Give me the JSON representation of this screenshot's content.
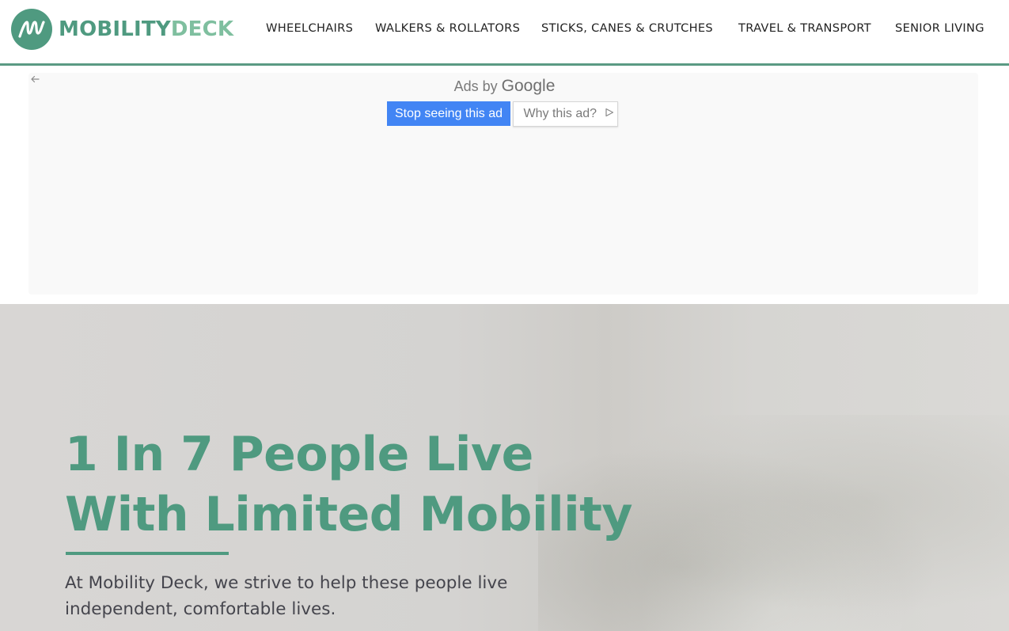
{
  "brand": {
    "name_part1": "MOBILITY",
    "name_part2": "DECK",
    "logo_icon": "mobility-deck-logo-icon",
    "colors": {
      "primary": "#4f9a80",
      "secondary": "#7fbf9f"
    }
  },
  "nav": {
    "items": [
      {
        "label": "WHEELCHAIRS"
      },
      {
        "label": "WALKERS & ROLLATORS"
      },
      {
        "label": "STICKS, CANES & CRUTCHES"
      },
      {
        "label": "TRAVEL & TRANSPORT"
      },
      {
        "label": "SENIOR LIVING"
      }
    ]
  },
  "ad": {
    "ads_by": "Ads by",
    "google": "Google",
    "stop_label": "Stop seeing this ad",
    "why_label": "Why this ad?",
    "back_icon": "back-arrow-icon",
    "why_icon": "play-triangle-icon",
    "colors": {
      "stop_button": "#4285f4"
    }
  },
  "hero": {
    "title_line1": "1 In 7 People Live",
    "title_line2": "With Limited Mobility",
    "subtitle_line1": "At Mobility Deck, we strive to help these people live",
    "subtitle_line2": "independent, comfortable lives."
  }
}
